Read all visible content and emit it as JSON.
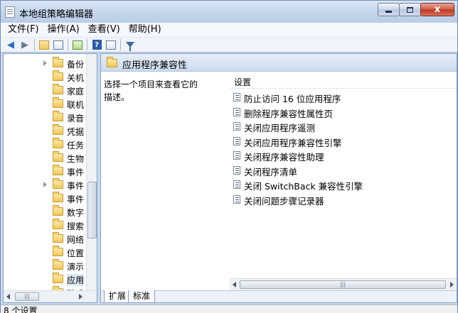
{
  "window": {
    "title": "本地组策略编辑器",
    "minimize_label": "",
    "maximize_label": "",
    "close_label": "x"
  },
  "menu": [
    "文件(F)",
    "操作(A)",
    "查看(V)",
    "帮助(H)"
  ],
  "toolbar": {
    "buttons": [
      "back-arrow-icon",
      "forward-arrow-icon",
      "up-folder-icon",
      "show-hide-tree-icon",
      "export-list-icon",
      "help-icon",
      "properties-icon",
      "filter-icon"
    ]
  },
  "tree": {
    "items": [
      {
        "label": "备份",
        "expandable": true
      },
      {
        "label": "关机",
        "expandable": false
      },
      {
        "label": "家庭",
        "expandable": false
      },
      {
        "label": "联机",
        "expandable": false
      },
      {
        "label": "录音",
        "expandable": false
      },
      {
        "label": "凭据",
        "expandable": false
      },
      {
        "label": "任务",
        "expandable": false
      },
      {
        "label": "生物",
        "expandable": false
      },
      {
        "label": "事件",
        "expandable": false
      },
      {
        "label": "事件",
        "expandable": true
      },
      {
        "label": "事件",
        "expandable": false
      },
      {
        "label": "数字",
        "expandable": false
      },
      {
        "label": "搜索",
        "expandable": false
      },
      {
        "label": "网络",
        "expandable": false
      },
      {
        "label": "位置",
        "expandable": false
      },
      {
        "label": "演示",
        "expandable": false
      },
      {
        "label": "应用",
        "expandable": false,
        "selected": true
      },
      {
        "label": "游戏",
        "expandable": false
      }
    ],
    "hscroll_thumb": "|||"
  },
  "content": {
    "header_title": "应用程序兼容性",
    "description": "选择一个项目来查看它的描述。",
    "column_header": "设置",
    "settings": [
      "防止访问 16 位应用程序",
      "删除程序兼容性属性页",
      "关闭应用程序遥测",
      "关闭应用程序兼容性引擎",
      "关闭程序兼容性助理",
      "关闭程序清单",
      "关闭 SwitchBack 兼容性引擎",
      "关闭问题步骤记录器"
    ],
    "hscroll_thumb": "|||"
  },
  "tabs": [
    "扩展",
    "标准"
  ],
  "status": "8 个设置"
}
